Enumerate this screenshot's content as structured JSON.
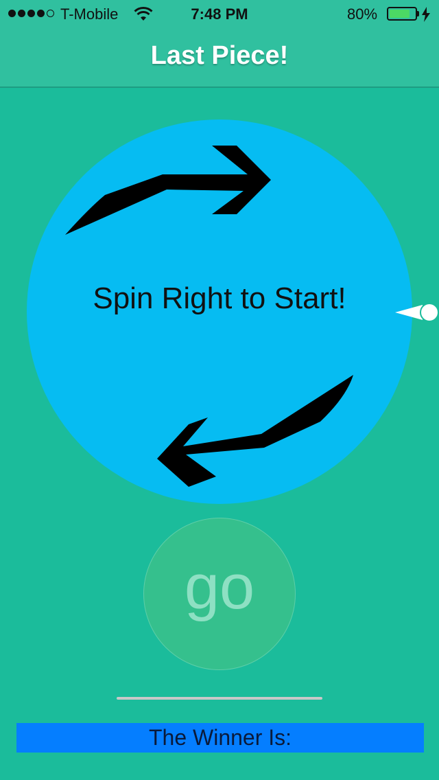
{
  "status_bar": {
    "carrier": "T-Mobile",
    "time": "7:48 PM",
    "battery_percent_text": "80%",
    "battery_level": 0.8,
    "signal_filled_dots": 4,
    "signal_total_dots": 5,
    "icons": [
      "signal-dots-icon",
      "wifi-icon",
      "battery-icon",
      "charging-bolt-icon"
    ]
  },
  "nav": {
    "title": "Last Piece!"
  },
  "wheel": {
    "label": "Spin Right to Start!",
    "color": "#06bcf2",
    "icons": [
      "arrow-right-icon",
      "arrow-left-icon"
    ]
  },
  "pointer": {
    "icon": "wheel-pointer-icon"
  },
  "go_button": {
    "label": "go"
  },
  "result": {
    "label": "The Winner Is:"
  },
  "colors": {
    "background": "#1bbc9b",
    "nav_bar": "#30c09f",
    "go_button": "#35c08d",
    "winner_bar": "#057eff",
    "battery_fill": "#4cd964"
  }
}
